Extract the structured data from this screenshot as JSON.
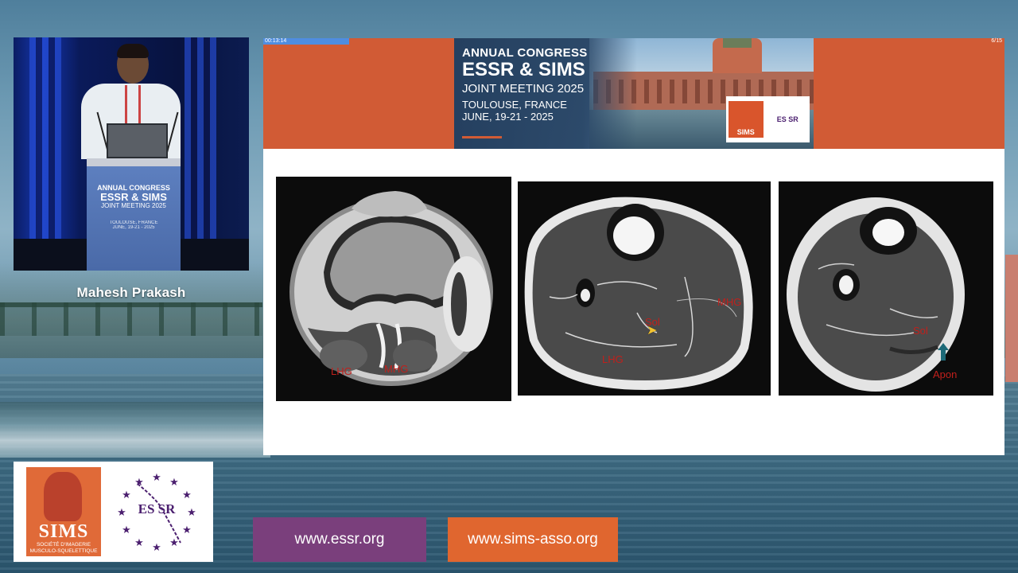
{
  "speaker": {
    "name": "Mahesh Prakash",
    "lectern": {
      "line1": "ANNUAL CONGRESS",
      "line2": "ESSR & SIMS",
      "line3": "JOINT MEETING 2025",
      "line4": "TOULOUSE, FRANCE",
      "line5": "JUNE, 19-21 - 2025"
    }
  },
  "slide": {
    "timer": "00:13:14",
    "page": "6/15",
    "progress_fraction": 0.12,
    "banner": {
      "line1": "ANNUAL CONGRESS",
      "line2": "ESSR & SIMS",
      "line3": "JOINT MEETING 2025",
      "line4": "TOULOUSE, FRANCE",
      "line5": "JUNE, 19-21 - 2025",
      "logo_sims": "SIMS",
      "logo_essr": "ES SR"
    },
    "images": [
      {
        "labels": {
          "a": "LHG",
          "b": "MHG"
        }
      },
      {
        "labels": {
          "a": "MHG",
          "b": "Sol",
          "c": "LHG"
        }
      },
      {
        "labels": {
          "a": "Sol",
          "b": "Apon"
        }
      }
    ]
  },
  "logos": {
    "sims_word": "SIMS",
    "sims_sub1": "SOCIÉTÉ D'IMAGERIE",
    "sims_sub2": "MUSCULO-SQUELETTIQUE",
    "essr_word": "ES SR"
  },
  "links": {
    "essr": "www.essr.org",
    "sims": "www.sims-asso.org"
  },
  "colors": {
    "slide_header": "#d15b35",
    "essr_button": "#7a3f7c",
    "sims_button": "#e0662f",
    "label_red": "#c0201c"
  }
}
